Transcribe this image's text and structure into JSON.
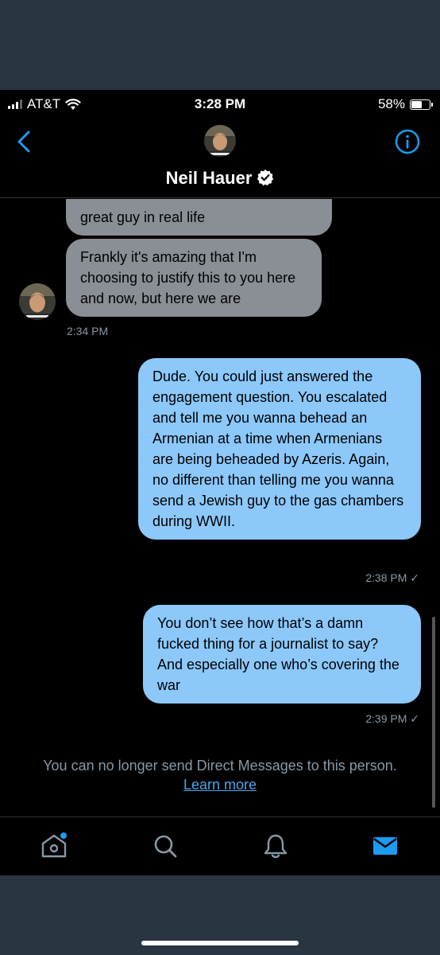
{
  "status_bar": {
    "carrier": "AT&T",
    "time": "3:28 PM",
    "battery_percent": "58%",
    "battery_level": 0.58
  },
  "header": {
    "contact_name": "Neil Hauer",
    "verified": true,
    "icons": {
      "back": "chevron-left-icon",
      "info": "info-circle-icon",
      "verified": "verified-badge-icon"
    }
  },
  "messages": [
    {
      "direction": "incoming",
      "text": "great guy in real life",
      "partial": true
    },
    {
      "direction": "incoming",
      "text": "Frankly it's amazing that I'm choosing to justify this to you here and now, but here we are",
      "timestamp": "2:34 PM"
    },
    {
      "direction": "outgoing",
      "text": "Dude. You could just answered the engagement question. You escalated and tell me you wanna behead an Armenian at a time when Armenians are being beheaded by Azeris. Again, no different than telling me you wanna send a Jewish guy to the gas chambers during WWII.",
      "timestamp": "2:38 PM ✓"
    },
    {
      "direction": "outgoing",
      "text": "You don’t see how that’s a damn fucked thing for a journalist to say? And especially one who’s covering the war",
      "timestamp": "2:39 PM ✓"
    }
  ],
  "notice": {
    "text": "You can no longer send Direct Messages to this person.",
    "link_label": "Learn more"
  },
  "tab_bar": {
    "items": [
      "home-icon",
      "search-icon",
      "notifications-icon",
      "messages-icon"
    ],
    "active": "messages-icon",
    "accent_color": "#1d9bf0"
  },
  "colors": {
    "incoming_bubble": "#8a8f96",
    "outgoing_bubble": "#8cc8fa",
    "link": "#4aa6ee"
  }
}
